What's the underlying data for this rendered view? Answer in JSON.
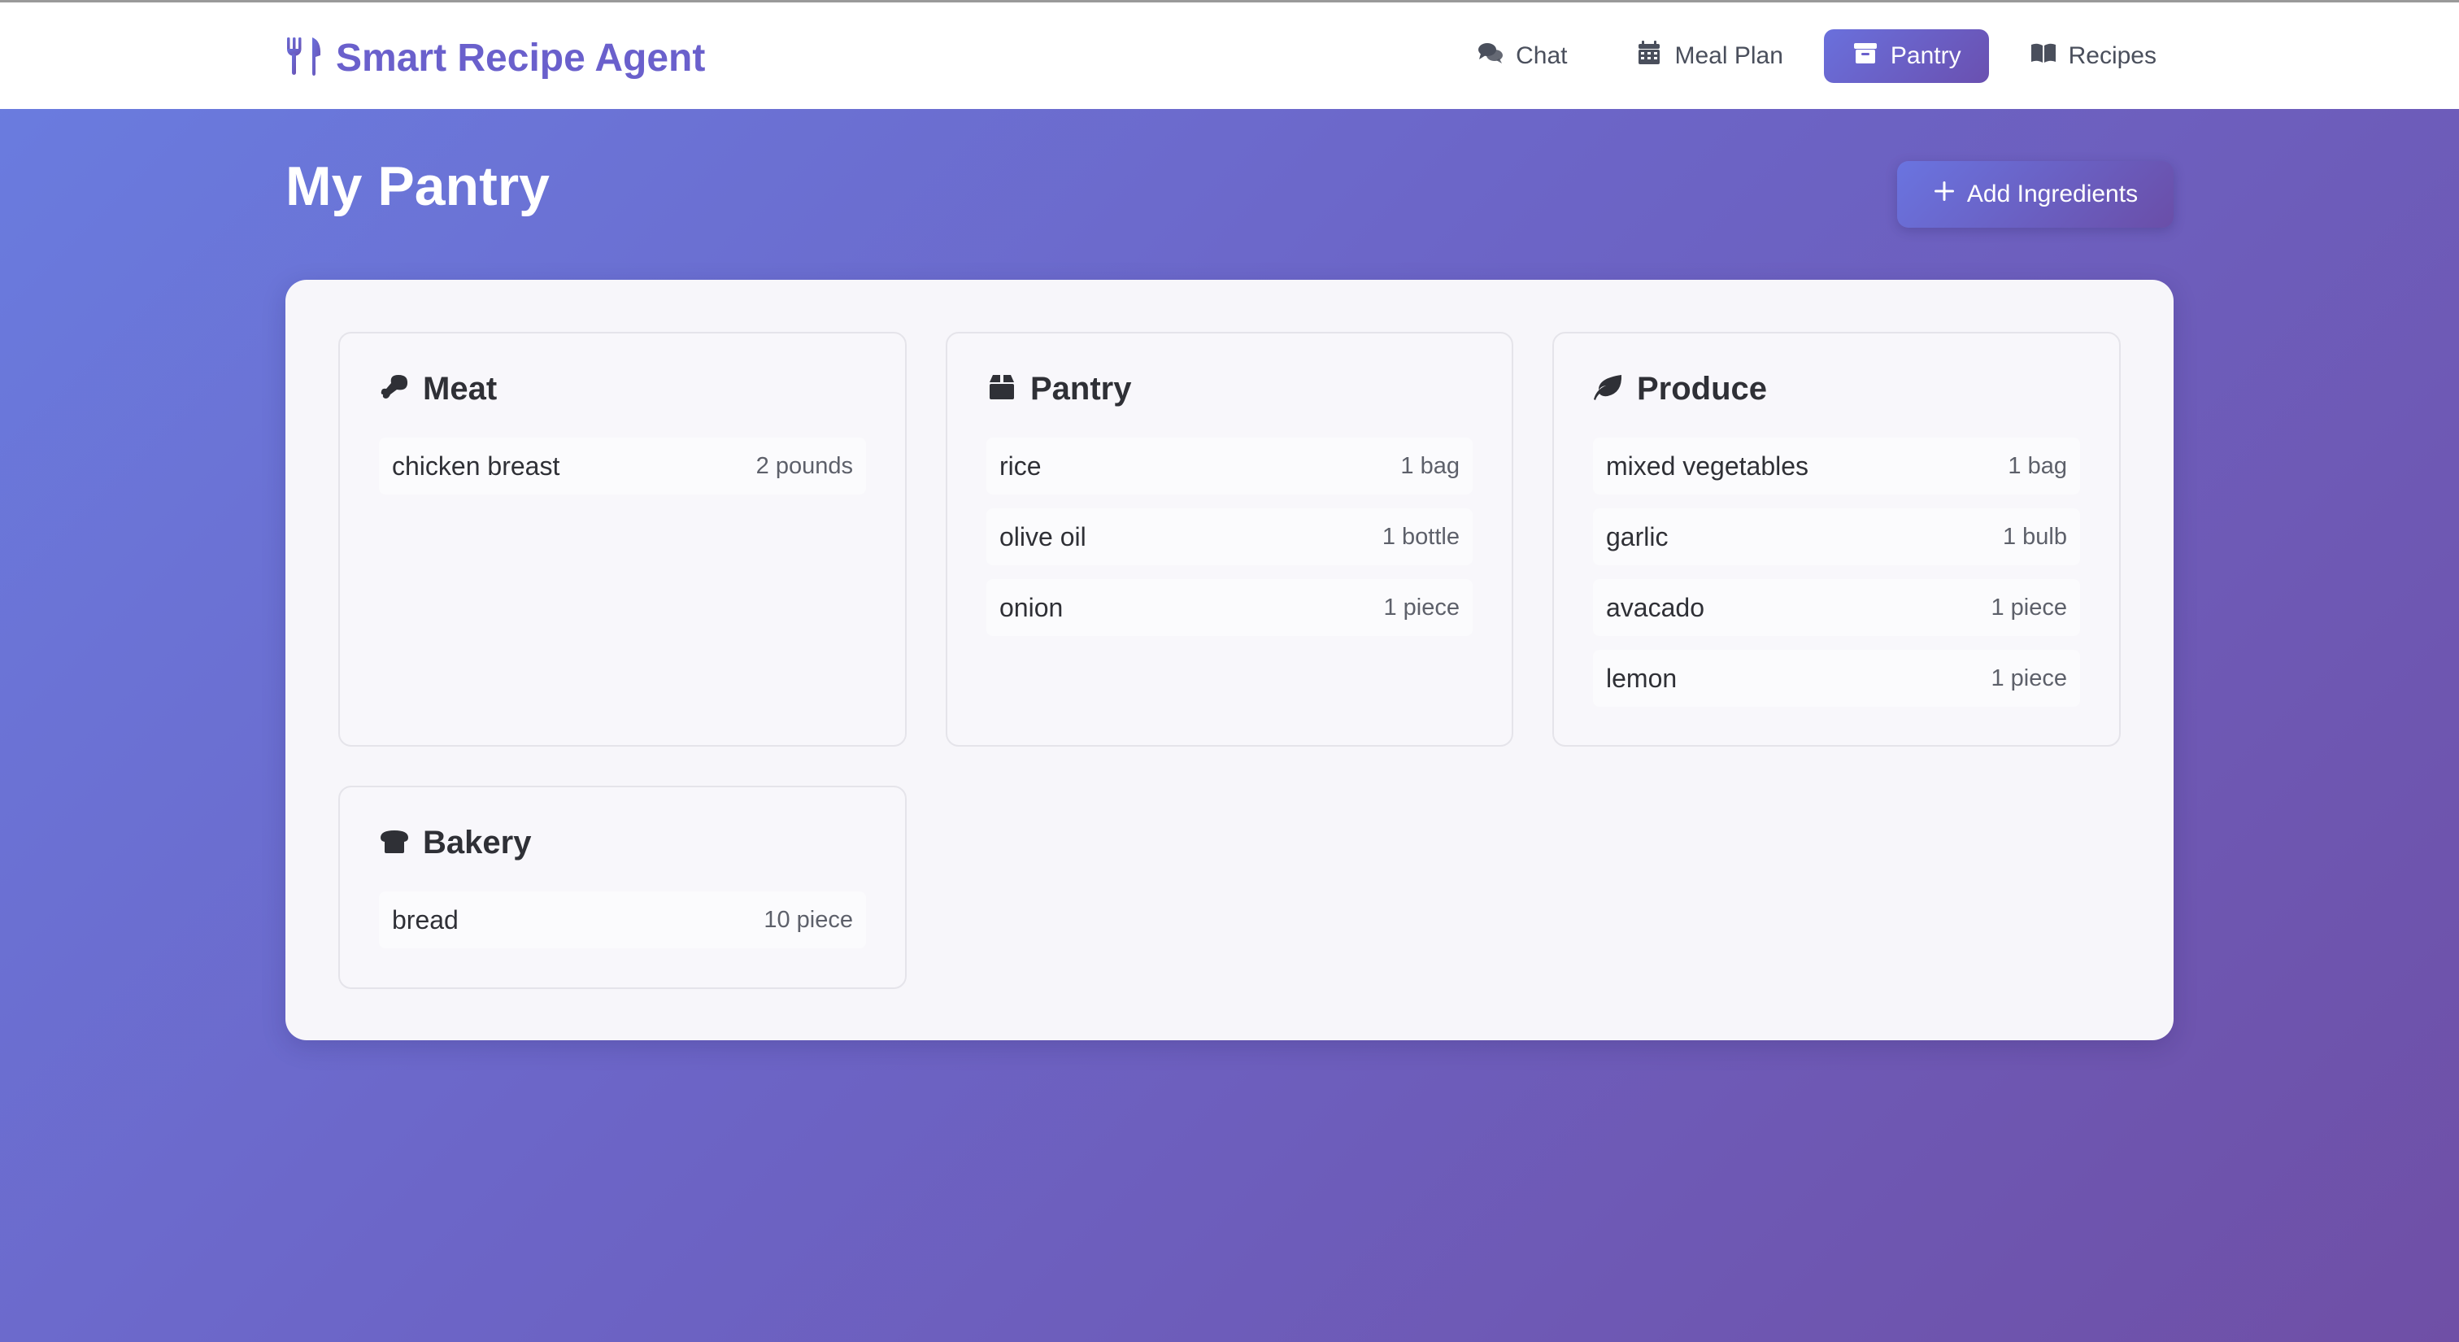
{
  "app": {
    "title": "Smart Recipe Agent",
    "brand_icon": "utensils-icon"
  },
  "nav": {
    "items": [
      {
        "label": "Chat",
        "icon": "comments-icon",
        "active": false
      },
      {
        "label": "Meal Plan",
        "icon": "calendar-icon",
        "active": false
      },
      {
        "label": "Pantry",
        "icon": "archive-box-icon",
        "active": true
      },
      {
        "label": "Recipes",
        "icon": "book-open-icon",
        "active": false
      }
    ]
  },
  "page": {
    "title": "My Pantry",
    "add_button_label": "Add Ingredients",
    "add_button_icon": "plus-icon"
  },
  "categories": [
    {
      "name": "Meat",
      "icon": "drumstick-icon",
      "items": [
        {
          "name": "chicken breast",
          "qty": "2 pounds"
        }
      ]
    },
    {
      "name": "Pantry",
      "icon": "box-icon",
      "items": [
        {
          "name": "rice",
          "qty": "1 bag"
        },
        {
          "name": "olive oil",
          "qty": "1 bottle"
        },
        {
          "name": "onion",
          "qty": "1 piece"
        }
      ]
    },
    {
      "name": "Produce",
      "icon": "leaf-icon",
      "items": [
        {
          "name": "mixed vegetables",
          "qty": "1 bag"
        },
        {
          "name": "garlic",
          "qty": "1 bulb"
        },
        {
          "name": "avacado",
          "qty": "1 piece"
        },
        {
          "name": "lemon",
          "qty": "1 piece"
        }
      ]
    },
    {
      "name": "Bakery",
      "icon": "bread-icon",
      "items": [
        {
          "name": "bread",
          "qty": "10 piece"
        }
      ]
    }
  ],
  "colors": {
    "accent": "#6a60cc",
    "background_start": "#6a7de0",
    "background_end": "#6f4fa6",
    "text_dark": "#2f3036"
  }
}
